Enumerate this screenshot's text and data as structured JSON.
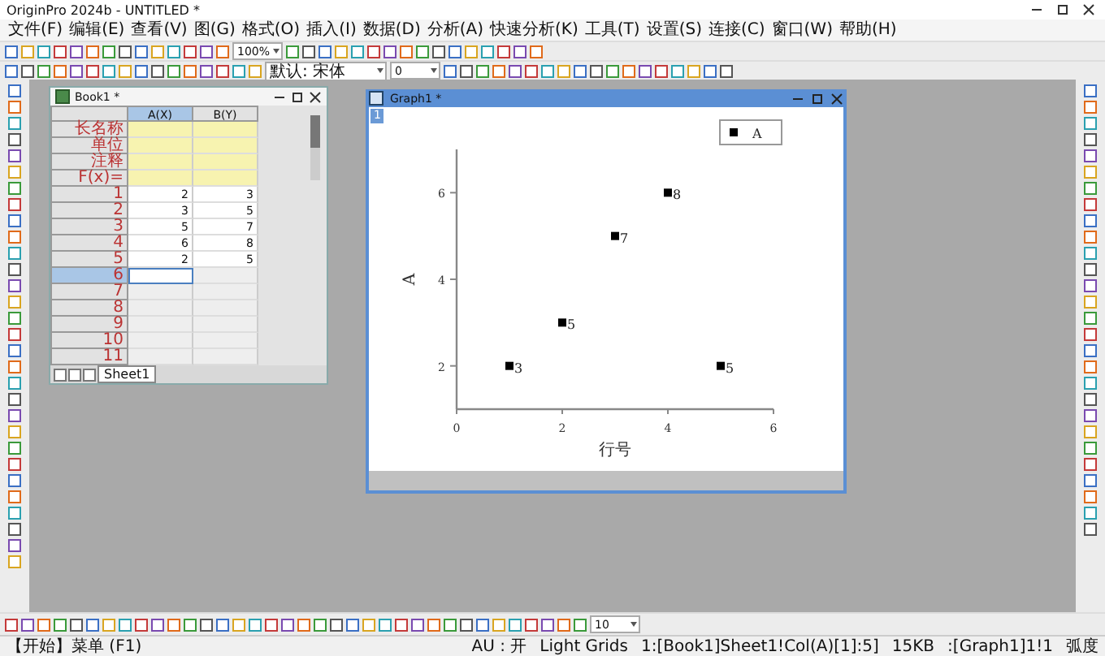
{
  "window": {
    "title": "OriginPro 2024b - UNTITLED *"
  },
  "menu": [
    "文件(F)",
    "编辑(E)",
    "查看(V)",
    "图(G)",
    "格式(O)",
    "插入(I)",
    "数据(D)",
    "分析(A)",
    "快速分析(K)",
    "工具(T)",
    "设置(S)",
    "连接(C)",
    "窗口(W)",
    "帮助(H)"
  ],
  "toolbar": {
    "zoom": "100%",
    "font": "默认: 宋体",
    "font_size": "0",
    "bottom_size": "10"
  },
  "workbook": {
    "title": "Book1 *",
    "columns": [
      {
        "label": "A(X)",
        "selected": true
      },
      {
        "label": "B(Y)",
        "selected": false
      }
    ],
    "label_rows": [
      "长名称",
      "单位",
      "注释",
      "F(x)="
    ],
    "rows": [
      {
        "num": "1",
        "cells": [
          "2",
          "3"
        ],
        "selected": false
      },
      {
        "num": "2",
        "cells": [
          "3",
          "5"
        ],
        "selected": false
      },
      {
        "num": "3",
        "cells": [
          "5",
          "7"
        ],
        "selected": false
      },
      {
        "num": "4",
        "cells": [
          "6",
          "8"
        ],
        "selected": false
      },
      {
        "num": "5",
        "cells": [
          "2",
          "5"
        ],
        "selected": false
      },
      {
        "num": "6",
        "cells": [],
        "selected": true
      },
      {
        "num": "7",
        "cells": [],
        "selected": false
      },
      {
        "num": "8",
        "cells": [],
        "selected": false
      },
      {
        "num": "9",
        "cells": [],
        "selected": false
      },
      {
        "num": "10",
        "cells": [],
        "selected": false
      },
      {
        "num": "11",
        "cells": [],
        "selected": false
      }
    ],
    "sheet_tab": "Sheet1"
  },
  "graph": {
    "title": "Graph1 *",
    "layer": "1",
    "chart_data": {
      "type": "scatter",
      "xlabel": "行号",
      "ylabel": "A",
      "x": [
        1,
        2,
        3,
        4,
        5
      ],
      "series": [
        {
          "name": "A",
          "color": "#000000",
          "values": [
            2,
            3,
            5,
            6,
            2
          ]
        }
      ],
      "xlim": [
        0,
        6
      ],
      "ylim": [
        1,
        7
      ],
      "xticks": [
        0,
        2,
        4,
        6
      ],
      "yticks": [
        2,
        4,
        6
      ],
      "value_labels": [
        "3",
        "5",
        "7",
        "8",
        "5"
      ]
    }
  },
  "status_bar": {
    "left": "【开始】菜单 (F1)",
    "items": [
      "AU : 开",
      "Light Grids",
      "1:[Book1]Sheet1!Col(A)[1]:5]",
      "15KB",
      ":[Graph1]1!1",
      "弧度"
    ]
  }
}
